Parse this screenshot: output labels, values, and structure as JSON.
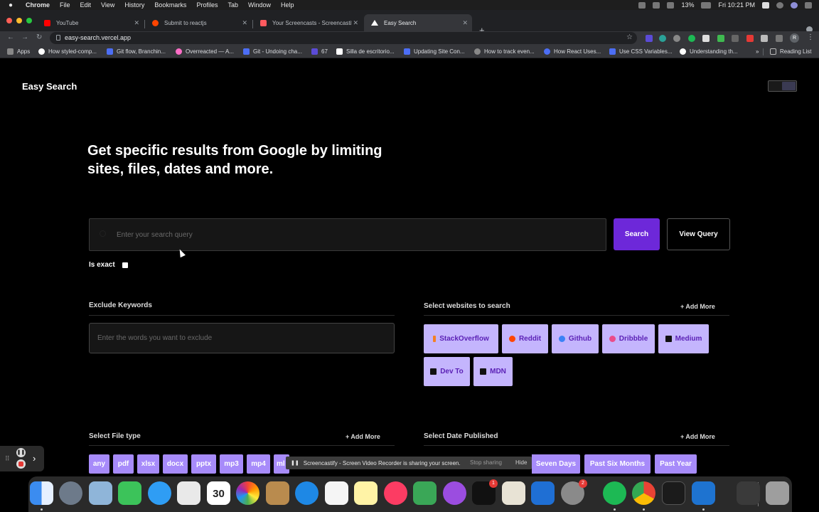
{
  "menubar": {
    "app_name": "Chrome",
    "items": [
      "File",
      "Edit",
      "View",
      "History",
      "Bookmarks",
      "Profiles",
      "Tab",
      "Window",
      "Help"
    ],
    "battery": "13%",
    "clock": "Fri 10:21 PM"
  },
  "tabs": [
    {
      "title": "YouTube",
      "color": "#ff0000"
    },
    {
      "title": "Submit to reactjs",
      "color": "#ff4500"
    },
    {
      "title": "Your Screencasts - Screencastify",
      "color": "#ff5a5f"
    },
    {
      "title": "Easy Search",
      "color": "#ffffff"
    }
  ],
  "address_bar": {
    "url": "easy-search.vercel.app"
  },
  "bookmarks": [
    "Apps",
    "How styled-comp...",
    "Git flow, Branchin...",
    "Overreacted — A...",
    "Git - Undoing cha...",
    "67",
    "Silla de escritorio...",
    "Updating Site Con...",
    "How to track even...",
    "How React Uses...",
    "Use CSS Variables...",
    "Understanding th...",
    "»",
    "Reading List"
  ],
  "page": {
    "logo": "Easy Search",
    "hero": "Get specific results from Google by limiting sites, files, dates and more.",
    "search": {
      "placeholder": "Enter your search query",
      "button": "Search",
      "view_query": "View Query"
    },
    "exact_label": "Is exact",
    "exclude": {
      "title": "Exclude Keywords",
      "placeholder": "Enter the words you want to exclude"
    },
    "websites": {
      "title": "Select websites to search",
      "add_more": "+ Add More",
      "items": [
        {
          "label": "StackOverflow",
          "icon": "stackoverflow-icon",
          "color": "#f48024"
        },
        {
          "label": "Reddit",
          "icon": "reddit-icon",
          "color": "#ff4500"
        },
        {
          "label": "Github",
          "icon": "github-icon",
          "color": "#3b82f6"
        },
        {
          "label": "Dribbble",
          "icon": "dribbble-icon",
          "color": "#ea4c89"
        },
        {
          "label": "Medium",
          "icon": "medium-icon",
          "color": "#111111"
        },
        {
          "label": "Dev To",
          "icon": "devto-icon",
          "color": "#111111"
        },
        {
          "label": "MDN",
          "icon": "mdn-icon",
          "color": "#111111"
        }
      ]
    },
    "file_type": {
      "title": "Select File type",
      "add_more": "+ Add More",
      "items": [
        "any",
        "pdf",
        "xlsx",
        "docx",
        "pptx",
        "mp3",
        "mp4",
        "ml"
      ]
    },
    "date": {
      "title": "Select Date Published",
      "add_more": "+ Add More",
      "items": [
        "Seven Days",
        "Past Six Months",
        "Past Year"
      ]
    }
  },
  "screencastify": {
    "message": "Screencastify - Screen Video Recorder is sharing your screen.",
    "stop": "Stop sharing",
    "hide": "Hide"
  },
  "dock": {
    "badges": [
      "1",
      "2"
    ],
    "calendar_day": "30"
  }
}
